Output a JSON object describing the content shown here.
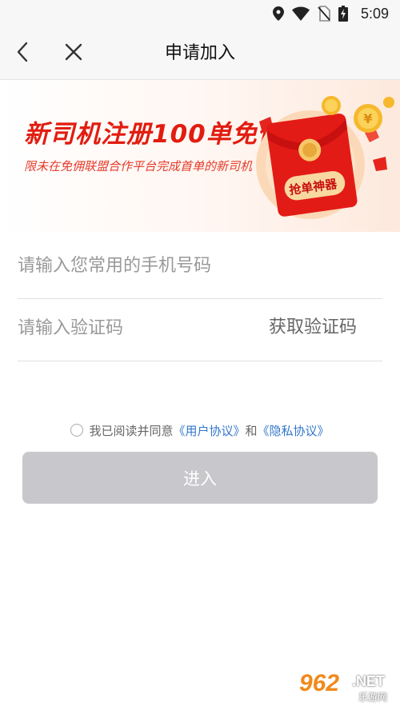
{
  "status_bar": {
    "time": "5:09"
  },
  "nav": {
    "title": "申请加入"
  },
  "banner": {
    "headline": "新司机注册100单免佣",
    "subline": "限未在免佣联盟合作平台完成首单的新司机",
    "art_label": "抢单神器"
  },
  "form": {
    "phone_placeholder": "请输入您常用的手机号码",
    "code_placeholder": "请输入验证码",
    "get_code_label": "获取验证码"
  },
  "agreement": {
    "prefix": "我已阅读并同意",
    "user_agreement": "《用户协议》",
    "conjunction": "和",
    "privacy_agreement": "《隐私协议》"
  },
  "submit_label": "进入",
  "watermark": {
    "number": "962",
    "net": ".NET",
    "cn": "乐游网"
  },
  "colors": {
    "link": "#3377cc",
    "banner_red": "#e11d10",
    "button_disabled": "#c8c8cc",
    "background": "#ffffff"
  }
}
